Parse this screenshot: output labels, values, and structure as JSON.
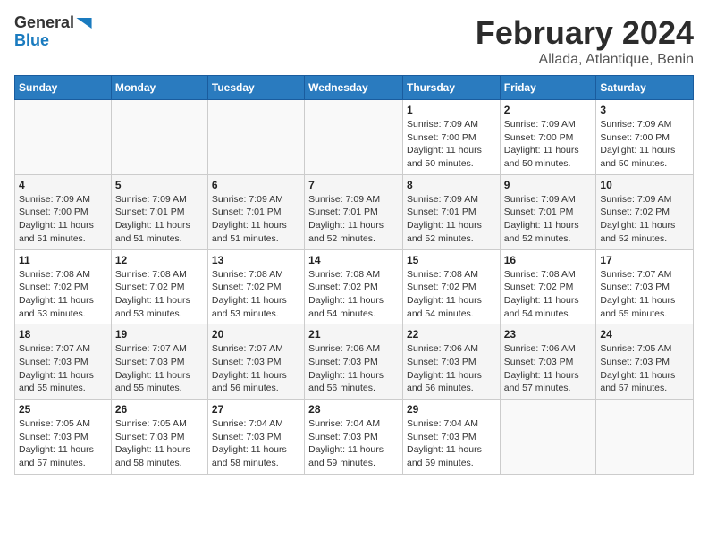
{
  "logo": {
    "text_general": "General",
    "text_blue": "Blue"
  },
  "title": "February 2024",
  "subtitle": "Allada, Atlantique, Benin",
  "weekdays": [
    "Sunday",
    "Monday",
    "Tuesday",
    "Wednesday",
    "Thursday",
    "Friday",
    "Saturday"
  ],
  "weeks": [
    [
      {
        "day": "",
        "info": ""
      },
      {
        "day": "",
        "info": ""
      },
      {
        "day": "",
        "info": ""
      },
      {
        "day": "",
        "info": ""
      },
      {
        "day": "1",
        "info": "Sunrise: 7:09 AM\nSunset: 7:00 PM\nDaylight: 11 hours and 50 minutes."
      },
      {
        "day": "2",
        "info": "Sunrise: 7:09 AM\nSunset: 7:00 PM\nDaylight: 11 hours and 50 minutes."
      },
      {
        "day": "3",
        "info": "Sunrise: 7:09 AM\nSunset: 7:00 PM\nDaylight: 11 hours and 50 minutes."
      }
    ],
    [
      {
        "day": "4",
        "info": "Sunrise: 7:09 AM\nSunset: 7:00 PM\nDaylight: 11 hours and 51 minutes."
      },
      {
        "day": "5",
        "info": "Sunrise: 7:09 AM\nSunset: 7:01 PM\nDaylight: 11 hours and 51 minutes."
      },
      {
        "day": "6",
        "info": "Sunrise: 7:09 AM\nSunset: 7:01 PM\nDaylight: 11 hours and 51 minutes."
      },
      {
        "day": "7",
        "info": "Sunrise: 7:09 AM\nSunset: 7:01 PM\nDaylight: 11 hours and 52 minutes."
      },
      {
        "day": "8",
        "info": "Sunrise: 7:09 AM\nSunset: 7:01 PM\nDaylight: 11 hours and 52 minutes."
      },
      {
        "day": "9",
        "info": "Sunrise: 7:09 AM\nSunset: 7:01 PM\nDaylight: 11 hours and 52 minutes."
      },
      {
        "day": "10",
        "info": "Sunrise: 7:09 AM\nSunset: 7:02 PM\nDaylight: 11 hours and 52 minutes."
      }
    ],
    [
      {
        "day": "11",
        "info": "Sunrise: 7:08 AM\nSunset: 7:02 PM\nDaylight: 11 hours and 53 minutes."
      },
      {
        "day": "12",
        "info": "Sunrise: 7:08 AM\nSunset: 7:02 PM\nDaylight: 11 hours and 53 minutes."
      },
      {
        "day": "13",
        "info": "Sunrise: 7:08 AM\nSunset: 7:02 PM\nDaylight: 11 hours and 53 minutes."
      },
      {
        "day": "14",
        "info": "Sunrise: 7:08 AM\nSunset: 7:02 PM\nDaylight: 11 hours and 54 minutes."
      },
      {
        "day": "15",
        "info": "Sunrise: 7:08 AM\nSunset: 7:02 PM\nDaylight: 11 hours and 54 minutes."
      },
      {
        "day": "16",
        "info": "Sunrise: 7:08 AM\nSunset: 7:02 PM\nDaylight: 11 hours and 54 minutes."
      },
      {
        "day": "17",
        "info": "Sunrise: 7:07 AM\nSunset: 7:03 PM\nDaylight: 11 hours and 55 minutes."
      }
    ],
    [
      {
        "day": "18",
        "info": "Sunrise: 7:07 AM\nSunset: 7:03 PM\nDaylight: 11 hours and 55 minutes."
      },
      {
        "day": "19",
        "info": "Sunrise: 7:07 AM\nSunset: 7:03 PM\nDaylight: 11 hours and 55 minutes."
      },
      {
        "day": "20",
        "info": "Sunrise: 7:07 AM\nSunset: 7:03 PM\nDaylight: 11 hours and 56 minutes."
      },
      {
        "day": "21",
        "info": "Sunrise: 7:06 AM\nSunset: 7:03 PM\nDaylight: 11 hours and 56 minutes."
      },
      {
        "day": "22",
        "info": "Sunrise: 7:06 AM\nSunset: 7:03 PM\nDaylight: 11 hours and 56 minutes."
      },
      {
        "day": "23",
        "info": "Sunrise: 7:06 AM\nSunset: 7:03 PM\nDaylight: 11 hours and 57 minutes."
      },
      {
        "day": "24",
        "info": "Sunrise: 7:05 AM\nSunset: 7:03 PM\nDaylight: 11 hours and 57 minutes."
      }
    ],
    [
      {
        "day": "25",
        "info": "Sunrise: 7:05 AM\nSunset: 7:03 PM\nDaylight: 11 hours and 57 minutes."
      },
      {
        "day": "26",
        "info": "Sunrise: 7:05 AM\nSunset: 7:03 PM\nDaylight: 11 hours and 58 minutes."
      },
      {
        "day": "27",
        "info": "Sunrise: 7:04 AM\nSunset: 7:03 PM\nDaylight: 11 hours and 58 minutes."
      },
      {
        "day": "28",
        "info": "Sunrise: 7:04 AM\nSunset: 7:03 PM\nDaylight: 11 hours and 59 minutes."
      },
      {
        "day": "29",
        "info": "Sunrise: 7:04 AM\nSunset: 7:03 PM\nDaylight: 11 hours and 59 minutes."
      },
      {
        "day": "",
        "info": ""
      },
      {
        "day": "",
        "info": ""
      }
    ]
  ]
}
